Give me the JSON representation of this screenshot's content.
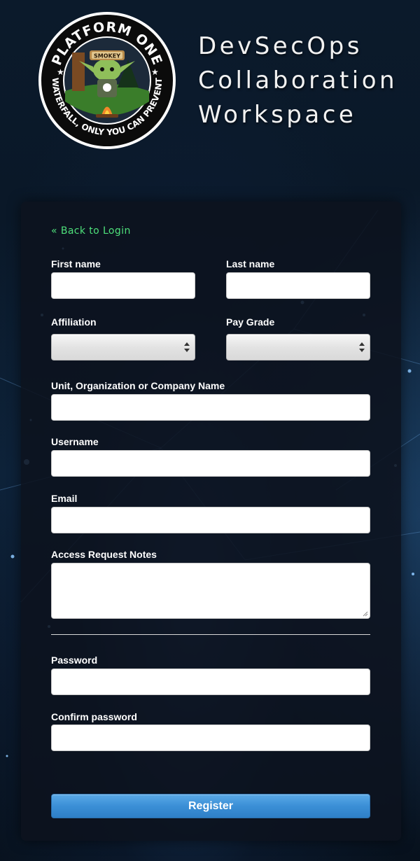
{
  "header": {
    "logo": {
      "top_text": "PLATFORM ONE",
      "bottom_text": "WATERFALL, ONLY YOU CAN PREVENT",
      "hat_text": "SMOKEY"
    },
    "title_lines": [
      "DevSecOps",
      "Collaboration",
      "Workspace"
    ]
  },
  "form": {
    "back_link": "« Back to Login",
    "first_name_label": "First name",
    "first_name_value": "",
    "last_name_label": "Last name",
    "last_name_value": "",
    "affiliation_label": "Affiliation",
    "affiliation_value": "",
    "pay_grade_label": "Pay Grade",
    "pay_grade_value": "",
    "organization_label": "Unit, Organization or Company Name",
    "organization_value": "",
    "username_label": "Username",
    "username_value": "",
    "email_label": "Email",
    "email_value": "",
    "notes_label": "Access Request Notes",
    "notes_value": "",
    "password_label": "Password",
    "confirm_password_label": "Confirm password",
    "register_label": "Register"
  },
  "colors": {
    "link": "#4ee07a",
    "button": "#3b8fd6",
    "card": "#0c121e"
  }
}
